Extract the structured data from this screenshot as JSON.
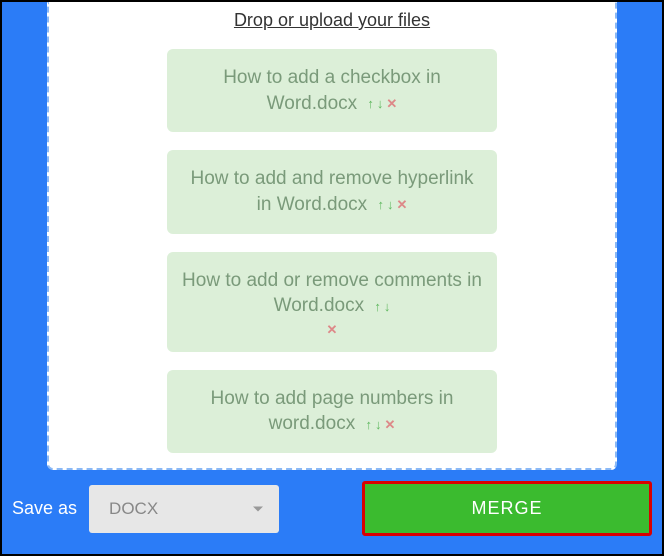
{
  "dropzone": {
    "header": "Drop or upload your files",
    "files": [
      {
        "name": "How to add a checkbox in Word.docx"
      },
      {
        "name": "How to add and remove hyperlink in Word.docx"
      },
      {
        "name": "How to add or remove comments in Word.docx"
      },
      {
        "name": "How to add page numbers in word.docx"
      }
    ]
  },
  "bottom": {
    "save_as_label": "Save as",
    "format": "DOCX",
    "merge_label": "MERGE"
  },
  "icons": {
    "up": "↑",
    "down": "↓",
    "remove": "✕"
  }
}
